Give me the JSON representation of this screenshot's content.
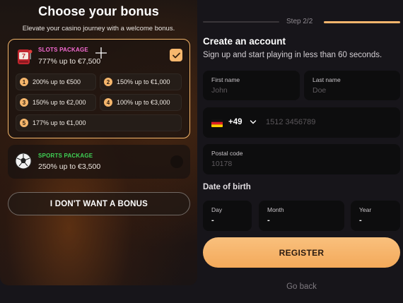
{
  "bonus": {
    "title": "Choose your bonus",
    "subtitle": "Elevate your casino journey with a welcome bonus.",
    "slots": {
      "name": "SLOTS PACKAGE",
      "offer": "777% up to €7,500",
      "selected": true,
      "tiers": [
        {
          "num": "1",
          "text": "200% up to €500"
        },
        {
          "num": "2",
          "text": "150% up to €1,000"
        },
        {
          "num": "3",
          "text": "150% up to €2,000"
        },
        {
          "num": "4",
          "text": "100% up to €3,000"
        },
        {
          "num": "5",
          "text": "177% up to €1,000"
        }
      ]
    },
    "sports": {
      "name": "SPORTS PACKAGE",
      "offer": "250% up to €3,500",
      "selected": false
    },
    "no_bonus_label": "I DON'T WANT A BONUS"
  },
  "step": {
    "label": "Step 2/2"
  },
  "form": {
    "title": "Create an account",
    "subtitle": "Sign up and start playing in less than 60 seconds.",
    "first_name": {
      "label": "First name",
      "placeholder": "John"
    },
    "last_name": {
      "label": "Last name",
      "placeholder": "Doe"
    },
    "phone": {
      "country_code": "+49",
      "placeholder": "1512 3456789"
    },
    "postal_code": {
      "label": "Postal code",
      "placeholder": "10178"
    },
    "dob": {
      "label": "Date of birth",
      "day": {
        "label": "Day",
        "value": "-"
      },
      "month": {
        "label": "Month",
        "value": "-"
      },
      "year": {
        "label": "Year",
        "value": "-"
      }
    },
    "register_label": "REGISTER",
    "go_back_label": "Go back"
  },
  "colors": {
    "accent": "#f6b76d",
    "slots_name": "#f56ad2",
    "sports_name": "#3fd255",
    "field_bg": "#0d0d0e",
    "page_bg": "#17151a"
  },
  "icons": {
    "slots": "slot-machine-icon",
    "sports": "soccer-ball-icon",
    "check": "check-icon",
    "flag": "germany-flag-icon",
    "chevron": "chevron-down-icon"
  }
}
